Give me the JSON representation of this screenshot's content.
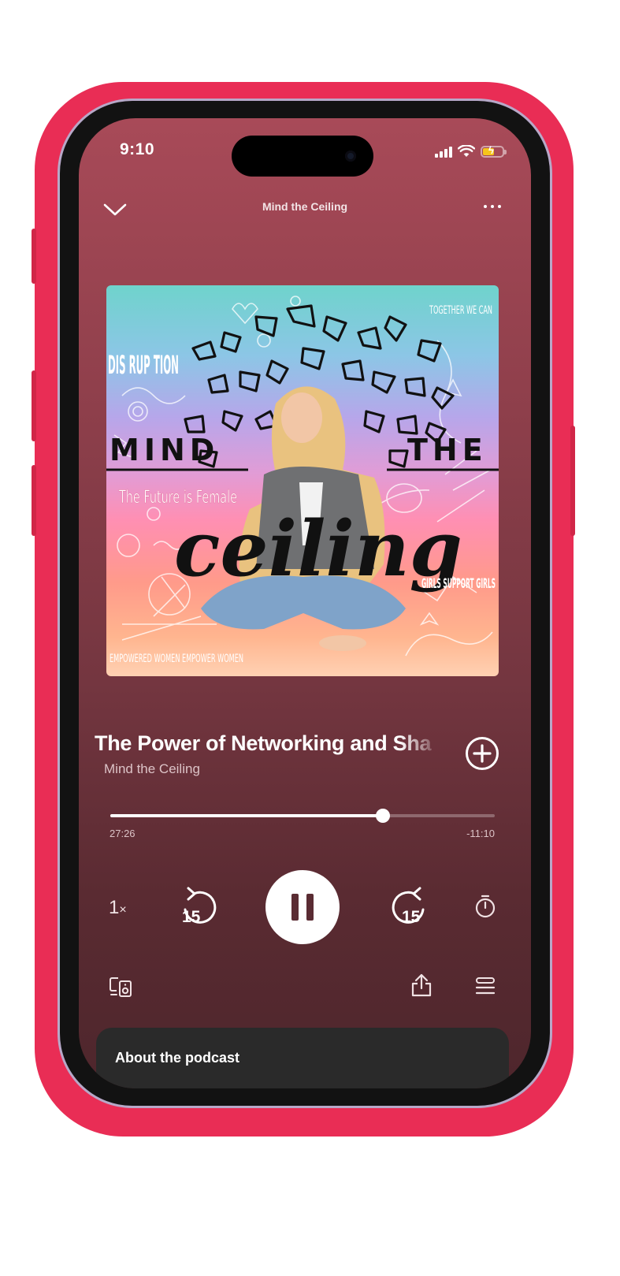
{
  "status_bar": {
    "time": "9:10"
  },
  "header": {
    "title": "Mind the Ceiling",
    "collapse_icon": "chevron-down-icon",
    "more_icon": "more-horizontal-icon"
  },
  "artwork": {
    "text_disruption": "DIS RUP TION",
    "text_together": "TOGETHER WE CAN",
    "text_mind": "MIND",
    "text_the": "THE",
    "text_future": "The Future is Female",
    "text_ceiling": "ceiling",
    "text_girls": "GIRLS SUPPORT GIRLS",
    "text_empowered": "EMPOWERED WOMEN EMPOWER WOMEN"
  },
  "episode": {
    "title": "The Power of Networking and Sha",
    "show": "Mind the Ceiling",
    "add_icon": "plus-circle-icon"
  },
  "progress": {
    "elapsed": "27:26",
    "remaining": "-11:10",
    "fraction": 0.708
  },
  "controls": {
    "speed": "1",
    "speed_suffix": "×",
    "skip_back_seconds": "15",
    "skip_forward_seconds": "15",
    "sleep_timer_icon": "timer-icon",
    "play_pause_icon": "pause-icon"
  },
  "bottom_actions": {
    "devices_icon": "devices-icon",
    "share_icon": "share-icon",
    "queue_icon": "queue-icon"
  },
  "about": {
    "title": "About the podcast"
  },
  "colors": {
    "case": "#e92d55",
    "background_top": "#a84a58",
    "background_bottom": "#4e262c",
    "about_card": "#2a2a2a"
  }
}
